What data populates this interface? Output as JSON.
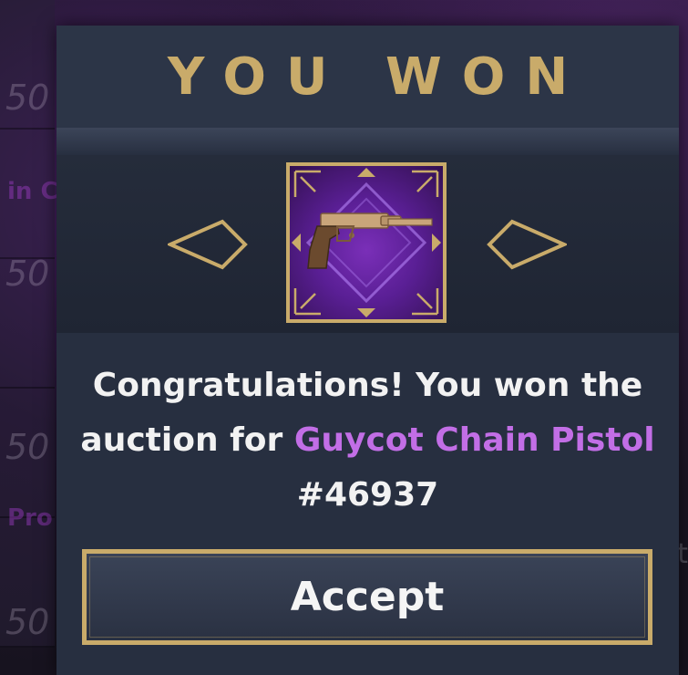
{
  "modal": {
    "title": "YOU WON",
    "item": {
      "name": "Guycot Chain Pistol",
      "icon": "pistol-icon"
    },
    "message": {
      "prefix": "Congratulations! You won the auction for ",
      "item_name": "Guycot Chain Pistol",
      "suffix": " #46937"
    },
    "accept_label": "Accept"
  },
  "background": {
    "prices": [
      "50",
      "50",
      "50",
      "50"
    ],
    "tags": [
      "in C",
      "Pro"
    ],
    "edge_letter": "t"
  },
  "colors": {
    "gold": "#c9ab6a",
    "panel": "#272f40",
    "highlight": "#c26ee6",
    "purple": "#5a1f95"
  }
}
